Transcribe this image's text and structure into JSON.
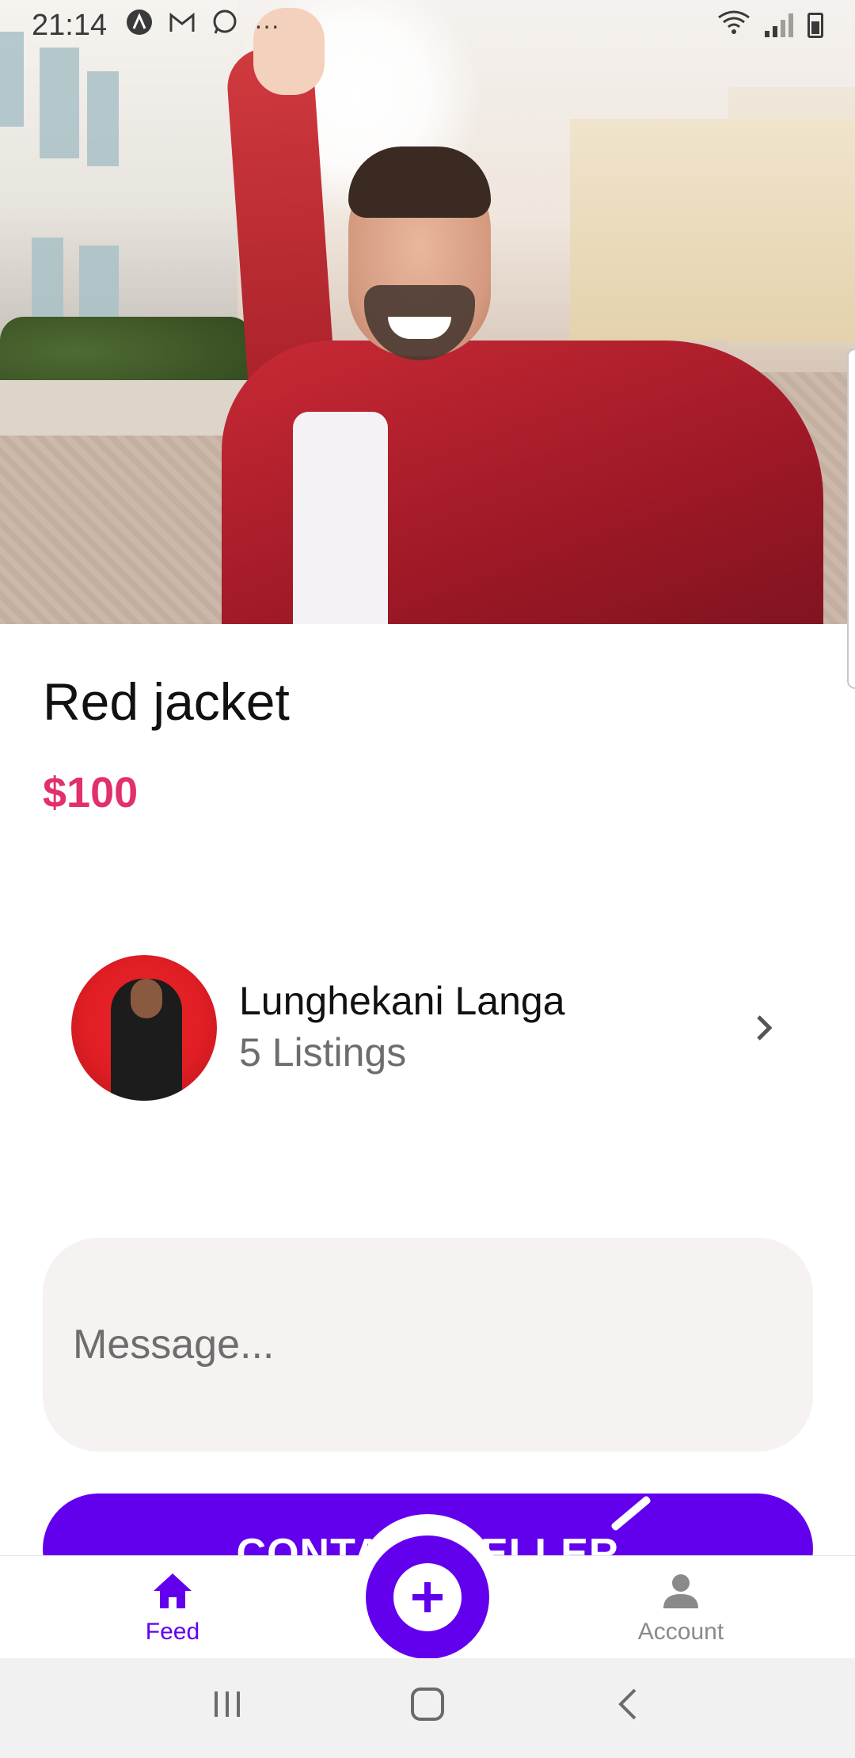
{
  "status_bar": {
    "time": "21:14",
    "icons": [
      "a-logo-icon",
      "gmail-icon",
      "whatsapp-icon",
      "more-icon"
    ],
    "more": "···"
  },
  "hero_image": {
    "description_icon": "photo-image"
  },
  "listing": {
    "title": "Red jacket",
    "price": "$100"
  },
  "seller": {
    "name": "Lunghekani Langa",
    "listings": "5 Listings"
  },
  "message": {
    "placeholder": "Message..."
  },
  "contact_button": {
    "label": "CONTACT SELLER"
  },
  "tabbar": {
    "feed_label": "Feed",
    "account_label": "Account"
  },
  "colors": {
    "accent": "#6200ee",
    "price": "#e1306c",
    "message_bg": "#f6f2f1"
  }
}
